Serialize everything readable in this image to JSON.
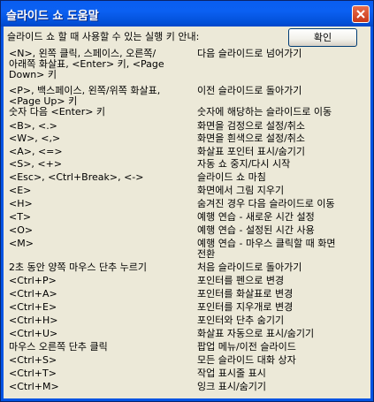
{
  "window": {
    "title": "슬라이드 쇼 도움말"
  },
  "intro_text": "슬라이드 쇼 할 때 사용할 수 있는 실행 키 안내:",
  "ok_label": "확인",
  "shortcuts": [
    {
      "key": "<N>, 왼쪽 클릭, 스페이스, 오른쪽/\n아래쪽 화살표, <Enter> 키, <Page\nDown> 키",
      "desc": "다음 슬라이드로 넘어가기"
    },
    {
      "key": "<P>, 백스페이스, 왼쪽/위쪽 화살표,\n<Page Up> 키",
      "desc": "이전 슬라이드로 돌아가기"
    },
    {
      "key": "숫자 다음 <Enter> 키",
      "desc": "숫자에 해당하는 슬라이드로 이동"
    },
    {
      "key": "<B>, <.>",
      "desc": "화면을 검정으로 설정/취소"
    },
    {
      "key": "<W>, <,>",
      "desc": "화면을 흰색으로 설정/취소"
    },
    {
      "key": "<A>, <=>",
      "desc": "화살표 포인터 표시/숨기기"
    },
    {
      "key": "<S>, <+>",
      "desc": "자동 쇼 중지/다시 시작"
    },
    {
      "key": "<Esc>, <Ctrl+Break>, <->",
      "desc": "슬라이드 쇼 마침"
    },
    {
      "key": "<E>",
      "desc": "화면에서 그림 지우기"
    },
    {
      "key": "<H>",
      "desc": "숨겨진 경우 다음 슬라이드로 이동"
    },
    {
      "key": "<T>",
      "desc": "예행 연습 - 새로운 시간 설정"
    },
    {
      "key": "<O>",
      "desc": "예행 연습 - 설정된 시간 사용"
    },
    {
      "key": "<M>",
      "desc": "예행 연습 - 마우스 클릭할 때 화면\n전환"
    },
    {
      "key": "2초 동안 양쪽 마우스 단추 누르기",
      "desc": "처음 슬라이드로 돌아가기"
    },
    {
      "key": "<Ctrl+P>",
      "desc": "포인터를 펜으로 변경"
    },
    {
      "key": "<Ctrl+A>",
      "desc": "포인터를 화살표로 변경"
    },
    {
      "key": "<Ctrl+E>",
      "desc": "포인터를 지우개로 변경"
    },
    {
      "key": "<Ctrl+H>",
      "desc": "포인터와 단추 숨기기"
    },
    {
      "key": "<Ctrl+U>",
      "desc": "화살표 자동으로 표시/숨기기"
    },
    {
      "key": "마우스 오른쪽 단추 클릭",
      "desc": "팝업 메뉴/이전 슬라이드"
    },
    {
      "key": "<Ctrl+S>",
      "desc": "모든 슬라이드 대화 상자"
    },
    {
      "key": "<Ctrl+T>",
      "desc": "작업 표시줄 표시"
    },
    {
      "key": "<Ctrl+M>",
      "desc": "잉크 표시/숨기기"
    }
  ]
}
